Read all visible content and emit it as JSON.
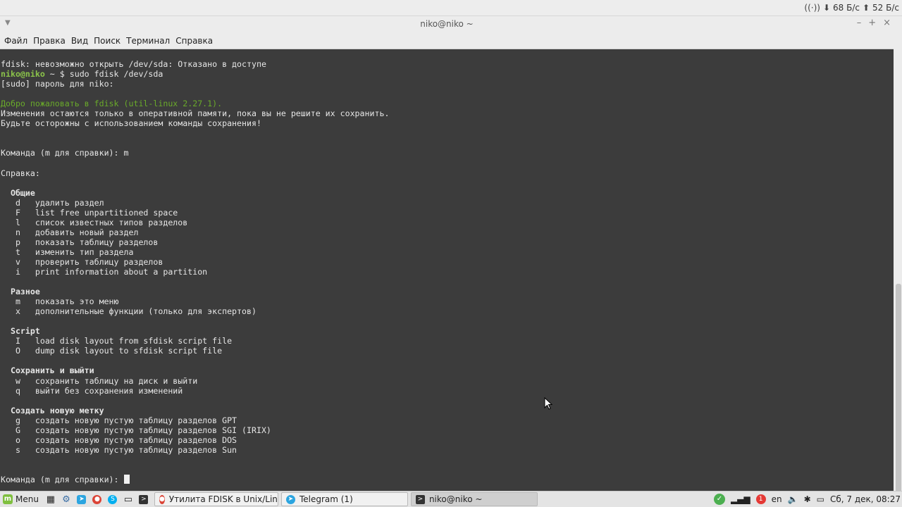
{
  "top_panel": {
    "download_speed": "68 Б/с",
    "upload_speed": "52 Б/с"
  },
  "window": {
    "title": "niko@niko ~",
    "menu": [
      "Файл",
      "Правка",
      "Вид",
      "Поиск",
      "Терминал",
      "Справка"
    ]
  },
  "terminal": {
    "lines": [
      {
        "text": "fdisk: невозможно открыть /dev/sda: Отказано в доступе"
      },
      {
        "prompt": "niko@niko",
        "path": " ~ $ ",
        "text": "sudo fdisk /dev/sda"
      },
      {
        "text": "[sudo] пароль для niko:"
      },
      {
        "text": ""
      },
      {
        "text": "Добро пожаловать в fdisk (util-linux 2.27.1).",
        "style": "dim-green"
      },
      {
        "text": "Изменения остаются только в оперативной памяти, пока вы не решите их сохранить."
      },
      {
        "text": "Будьте осторожны с использованием команды сохранения!"
      },
      {
        "text": ""
      },
      {
        "text": ""
      },
      {
        "text": "Команда (m для справки): m"
      },
      {
        "text": ""
      },
      {
        "text": "Справка:"
      },
      {
        "text": ""
      },
      {
        "text": "  Общие",
        "style": "bold"
      },
      {
        "text": "   d   удалить раздел"
      },
      {
        "text": "   F   list free unpartitioned space"
      },
      {
        "text": "   l   список известных типов разделов"
      },
      {
        "text": "   n   добавить новый раздел"
      },
      {
        "text": "   p   показать таблицу разделов"
      },
      {
        "text": "   t   изменить тип раздела"
      },
      {
        "text": "   v   проверить таблицу разделов"
      },
      {
        "text": "   i   print information about a partition"
      },
      {
        "text": ""
      },
      {
        "text": "  Разное",
        "style": "bold"
      },
      {
        "text": "   m   показать это меню"
      },
      {
        "text": "   x   дополнительные функции (только для экспертов)"
      },
      {
        "text": ""
      },
      {
        "text": "  Script",
        "style": "bold"
      },
      {
        "text": "   I   load disk layout from sfdisk script file"
      },
      {
        "text": "   O   dump disk layout to sfdisk script file"
      },
      {
        "text": ""
      },
      {
        "text": "  Сохранить и выйти",
        "style": "bold"
      },
      {
        "text": "   w   сохранить таблицу на диск и выйти"
      },
      {
        "text": "   q   выйти без сохранения изменений"
      },
      {
        "text": ""
      },
      {
        "text": "  Создать новую метку",
        "style": "bold"
      },
      {
        "text": "   g   создать новую пустую таблицу разделов GPT"
      },
      {
        "text": "   G   создать новую пустую таблицу разделов SGI (IRIX)"
      },
      {
        "text": "   o   создать новую пустую таблицу разделов DOS"
      },
      {
        "text": "   s   создать новую пустую таблицу разделов Sun"
      },
      {
        "text": ""
      },
      {
        "text": ""
      },
      {
        "text": "Команда (m для справки): ",
        "cursor": true
      }
    ]
  },
  "taskbar": {
    "menu_label": "Menu",
    "tasks": [
      {
        "label": "Утилита FDISK в Unix/Lin...",
        "icon": "chrome-icon"
      },
      {
        "label": "Telegram (1)",
        "icon": "telegram-icon"
      },
      {
        "label": "niko@niko ~",
        "icon": "terminal-icon",
        "active": true
      }
    ],
    "tray": {
      "updates_badge": "✓",
      "notif_count": "1",
      "keyboard_layout": "en",
      "datetime": "Сб, 7 дек, 08:27"
    }
  }
}
